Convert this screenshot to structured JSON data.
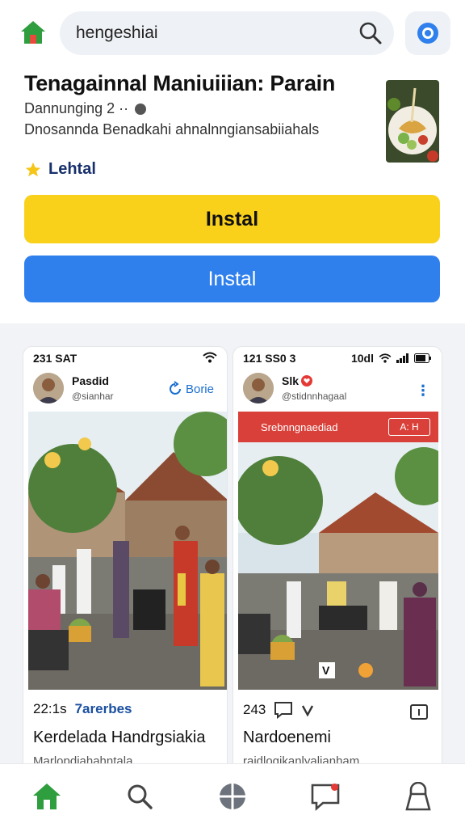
{
  "search": {
    "query": "hengeshiai"
  },
  "app": {
    "title": "Tenagainnal Maniuiiian: Parain",
    "meta": "Dannunging 2 ··",
    "description": "Dnosannda Benadkahi ahnalnngiansabiiahals",
    "rating_label": "Lehtal"
  },
  "buttons": {
    "primary": "Instal",
    "secondary": "Instal"
  },
  "cards": [
    {
      "status_time": "231 SAT",
      "status_right": "",
      "username": "Pasdid",
      "handle": "@sianhar",
      "follow_label": "Borie",
      "banner_text": "",
      "banner_tag": "",
      "stats": "22:1s",
      "tag": "7arerbes",
      "title": "Kerdelada Handrgsiakia",
      "subtitle": "Marlopdiahahntala"
    },
    {
      "status_time": "121 SS0 3",
      "status_right": "10dl",
      "username": "Slk",
      "handle": "@stidnnhagaal",
      "follow_label": "",
      "banner_text": "Srebnngnaediad",
      "banner_tag": "A: H",
      "stats": "243",
      "tag": "",
      "title": "Nardoenemi",
      "subtitle": "raidlogikanlyalianham",
      "overlay_letter": "V"
    }
  ],
  "colors": {
    "install_yellow": "#fad11a",
    "install_blue": "#2f80ed",
    "home_green": "#2e9e3f",
    "notification_red": "#e53935"
  },
  "nav": [
    "home-icon",
    "search-icon",
    "apps-icon",
    "messages-icon",
    "account-icon"
  ]
}
